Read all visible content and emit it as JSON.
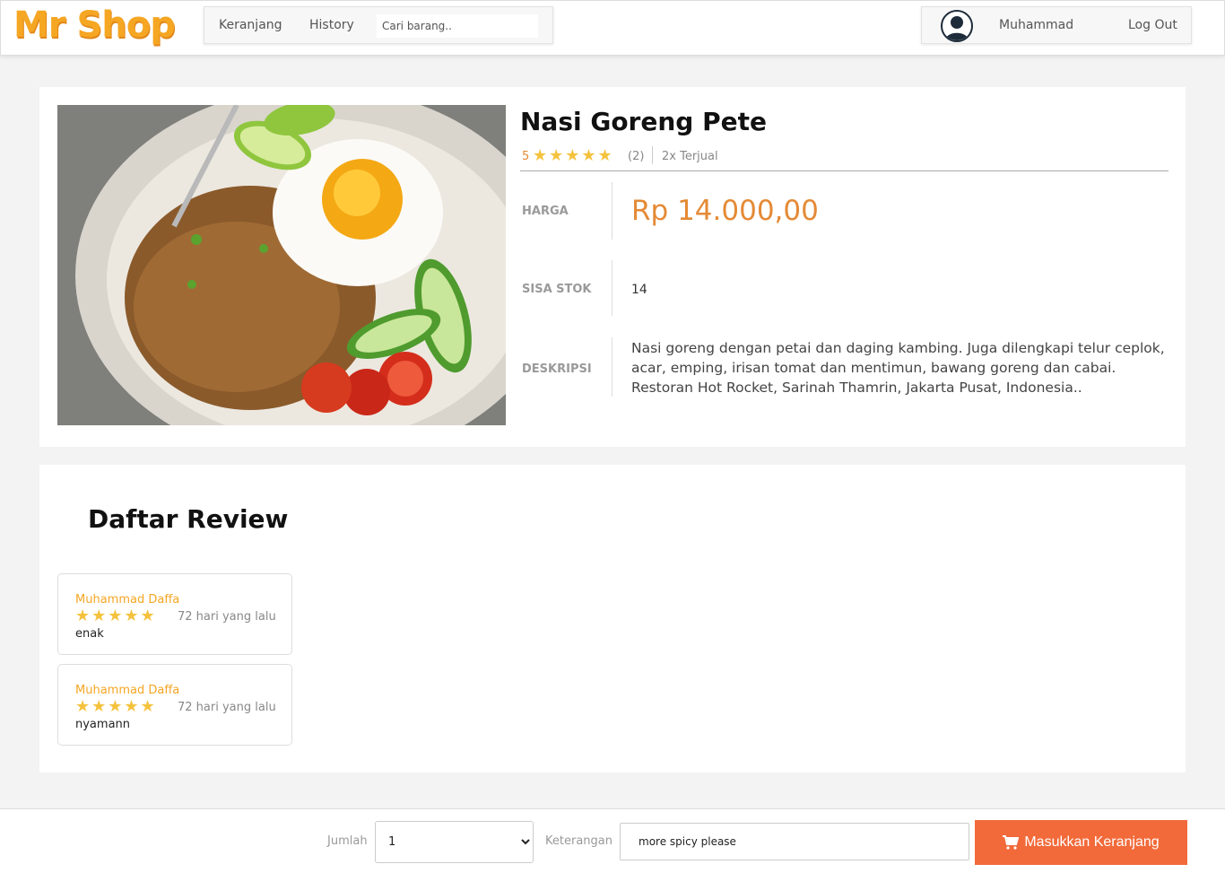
{
  "header": {
    "logo": "Mr Shop",
    "nav": {
      "cart": "Keranjang",
      "history": "History"
    },
    "search": {
      "placeholder": "Cari barang..",
      "value": ""
    },
    "user": {
      "name": "Muhammad",
      "logout": "Log Out",
      "avatar_icon": "user-avatar-icon"
    }
  },
  "product": {
    "title": "Nasi Goreng Pete",
    "rating": 5,
    "rating_display": "5",
    "stars": "★★★★★",
    "review_count": "(2)",
    "sold": "2x Terjual",
    "price_label": "HARGA",
    "price": "Rp 14.000,00",
    "stock_label": "SISA STOK",
    "stock": "14",
    "desc_label": "DESKRIPSI",
    "description": "Nasi goreng dengan petai dan daging kambing. Juga dilengkapi telur ceplok, acar, emping, irisan tomat dan mentimun, bawang goreng dan cabai. Restoran Hot Rocket, Sarinah Thamrin, Jakarta Pusat, Indonesia.."
  },
  "reviews": {
    "title": "Daftar Review",
    "items": [
      {
        "name": "Muhammad Daffa",
        "stars": "★★★★★",
        "rating": 5,
        "time": "72 hari yang lalu",
        "text": "enak"
      },
      {
        "name": "Muhammad Daffa",
        "stars": "★★★★★",
        "rating": 5,
        "time": "72 hari yang lalu",
        "text": "nyamann"
      }
    ]
  },
  "order": {
    "qty_label": "Jumlah",
    "qty_value": "1",
    "note_label": "Keterangan",
    "note_value": "more spicy please",
    "add_button": "Masukkan Keranjang",
    "add_icon": "cart-icon"
  },
  "colors": {
    "accent": "#f5a623",
    "price": "#e48a36",
    "star": "#f5c23d",
    "button": "#f26a3a"
  }
}
